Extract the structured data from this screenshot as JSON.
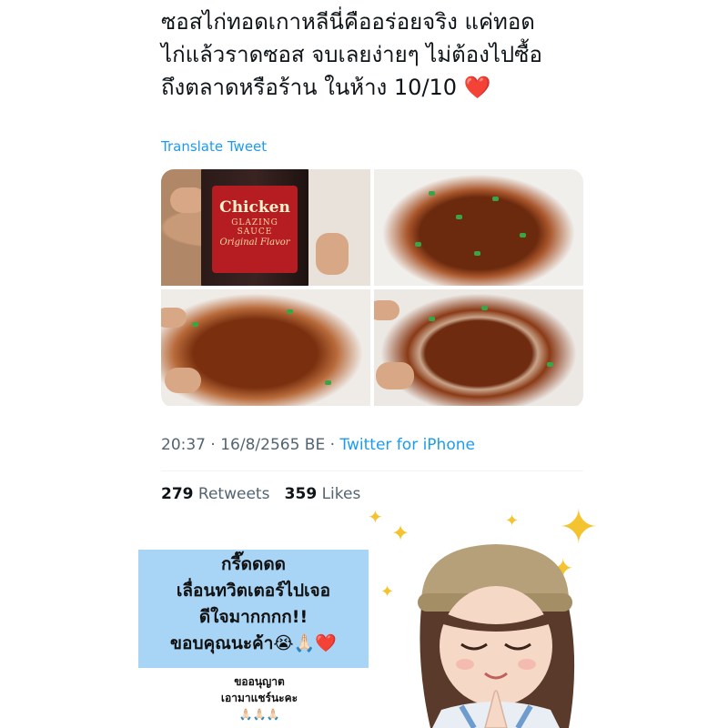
{
  "tweet": {
    "text": "ซอสไก่ทอดเกาหลีนี่คืออร่อยจริง แค่ทอด\nไก่แล้วราดซอส จบเลยง่ายๆ ไม่ต้องไปซื้อ\nถึงตลาดหรือร้าน ในห้าง 10/10 ",
    "heart": "❤️",
    "translate_label": "Translate Tweet",
    "photos": {
      "label_line1": "Chicken",
      "label_line2": "GLAZING SAUCE",
      "label_line3": "Original Flavor"
    },
    "time": "20:37",
    "date": "16/8/2565 BE",
    "separator": " · ",
    "source": "Twitter for iPhone",
    "retweet_count": "279",
    "retweet_label": "Retweets",
    "like_count": "359",
    "like_label": "Likes"
  },
  "overlay": {
    "note_lines": [
      "กรี๊ดดดด",
      "เลื่อนทวิตเตอร์ไปเจอ",
      "ดีใจมากกกก!!",
      "ขอบคุณนะค้า😭🙏🏻❤️"
    ],
    "small_lines": [
      "ขออนุญาต",
      "เอามาแชร์นะคะ",
      "🙏🏻🙏🏻🙏🏻"
    ],
    "sparkle_color": "#f4c430",
    "note_bg": "#a8d4f6"
  }
}
